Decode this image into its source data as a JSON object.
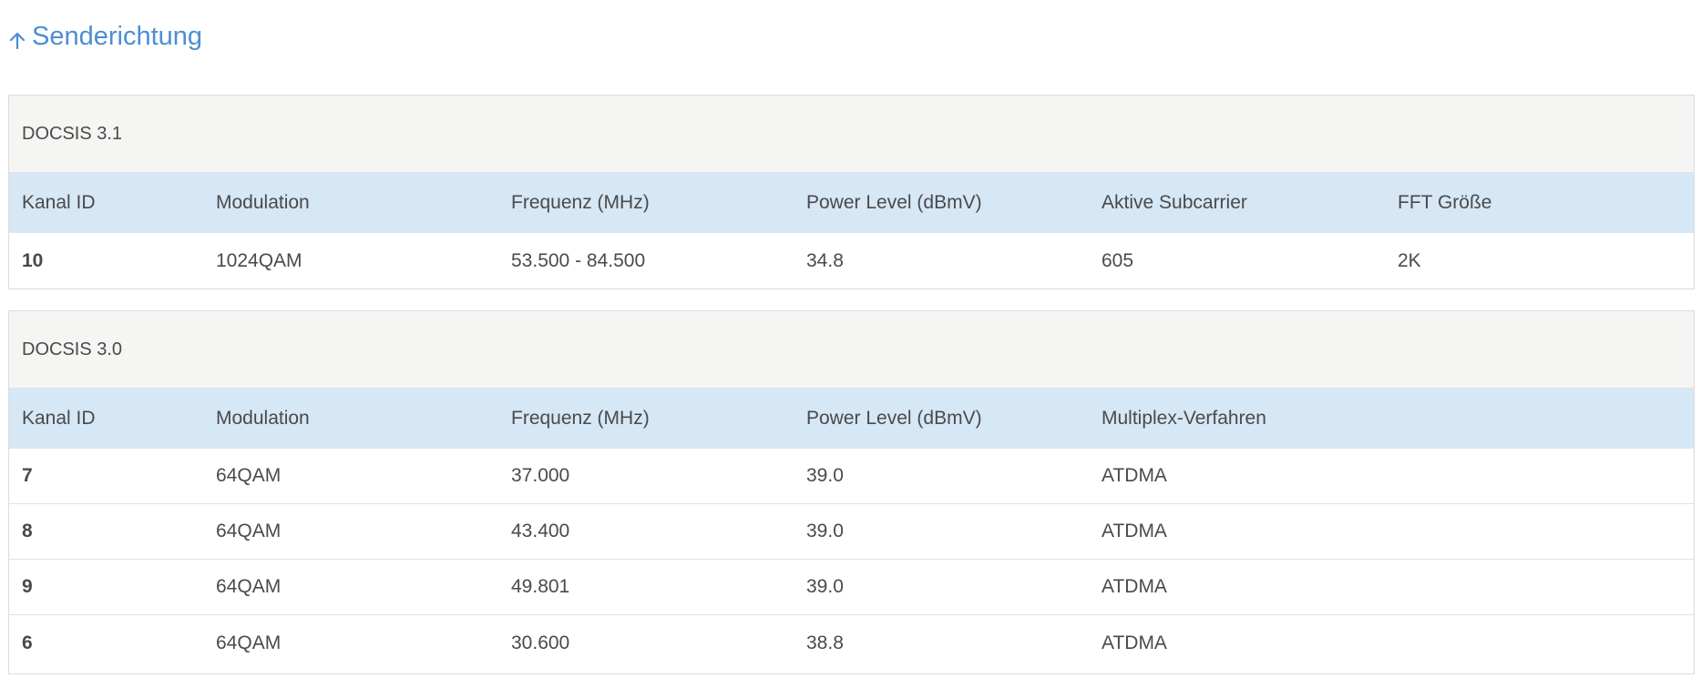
{
  "section": {
    "title": "Senderichtung"
  },
  "docsis31": {
    "title": "DOCSIS 3.1",
    "headers": [
      "Kanal ID",
      "Modulation",
      "Frequenz (MHz)",
      "Power Level (dBmV)",
      "Aktive Subcarrier",
      "FFT Größe"
    ],
    "rows": [
      [
        "10",
        "1024QAM",
        "53.500 - 84.500",
        "34.8",
        "605",
        "2K"
      ]
    ]
  },
  "docsis30": {
    "title": "DOCSIS 3.0",
    "headers": [
      "Kanal ID",
      "Modulation",
      "Frequenz (MHz)",
      "Power Level (dBmV)",
      "Multiplex-Verfahren"
    ],
    "rows": [
      [
        "7",
        "64QAM",
        "37.000",
        "39.0",
        "ATDMA"
      ],
      [
        "8",
        "64QAM",
        "43.400",
        "39.0",
        "ATDMA"
      ],
      [
        "9",
        "64QAM",
        "49.801",
        "39.0",
        "ATDMA"
      ],
      [
        "6",
        "64QAM",
        "30.600",
        "38.8",
        "ATDMA"
      ]
    ]
  },
  "colors": {
    "accent": "#4d8ed3",
    "header_row": "#d6e7f6",
    "panel_title_bg": "#f5f5f3"
  }
}
